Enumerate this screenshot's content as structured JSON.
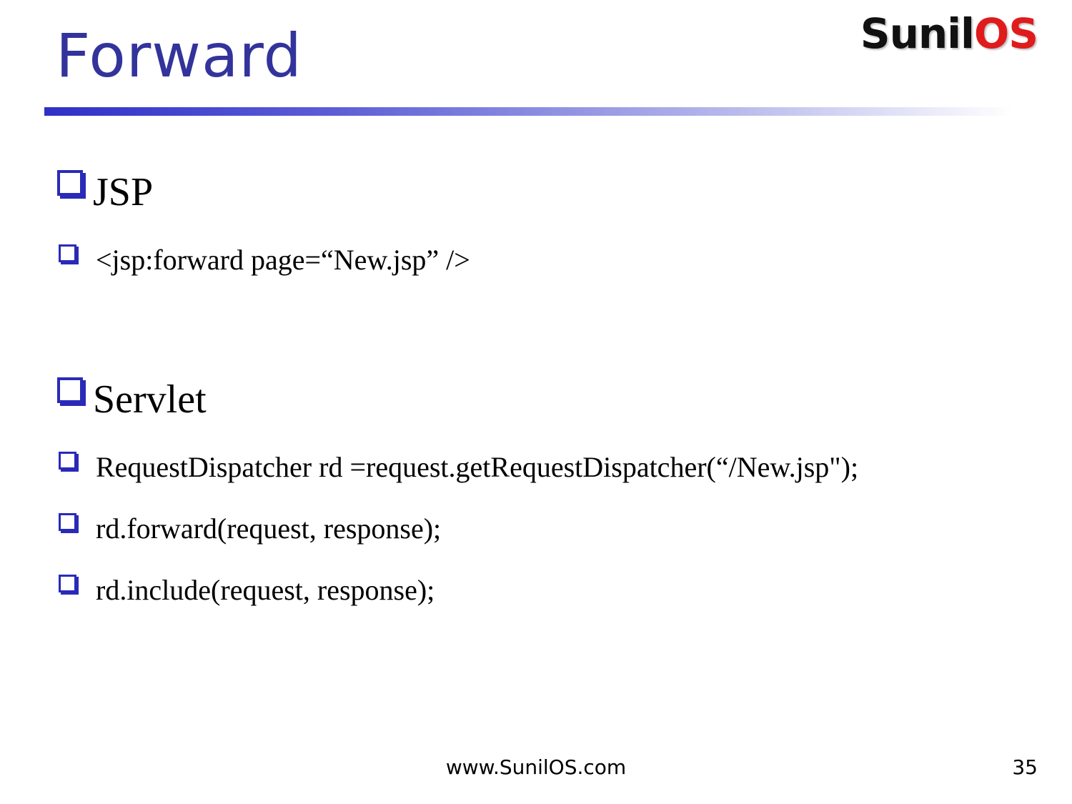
{
  "slide": {
    "title": "Forward",
    "logo": {
      "part1": "Sunil",
      "part2": "OS"
    }
  },
  "sections": [
    {
      "heading": "JSP",
      "bullets": [
        "<jsp:forward page=“New.jsp” />"
      ]
    },
    {
      "heading": "Servlet",
      "bullets": [
        "RequestDispatcher rd =request.getRequestDispatcher(“/New.jsp\");",
        "rd.forward(request, response);",
        "rd.include(request, response);"
      ]
    }
  ],
  "footer": {
    "url": "www.SunilOS.com",
    "page_number": "35"
  },
  "colors": {
    "title": "#33339c",
    "bullet_box": "#2a2ab8",
    "logo_dark": "#111111",
    "logo_red": "#e01b1b"
  },
  "icons": {
    "bullet": "hollow-square-shadow-icon"
  }
}
